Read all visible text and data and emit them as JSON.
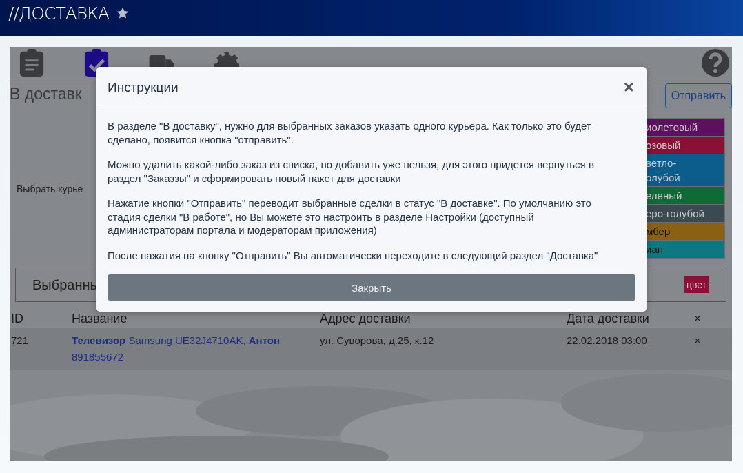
{
  "app_title": "//ДОСТАВКА",
  "favorite": true,
  "tabs": [
    {
      "kind": "list",
      "selected": false
    },
    {
      "kind": "check",
      "selected": true
    },
    {
      "kind": "truck",
      "selected": false
    },
    {
      "kind": "gear",
      "selected": false
    }
  ],
  "section_title": "В доставк",
  "send_button": "Отправить",
  "courier_label": "Выбрать курье",
  "colors": [
    {
      "lines": [
        "иолетовый"
      ],
      "color": "#5e1060"
    },
    {
      "lines": [
        "озовый"
      ],
      "color": "#8a1036"
    },
    {
      "lines": [
        "ветло-",
        "олубой"
      ],
      "color": "#0d5d8c"
    },
    {
      "lines": [
        "еленый"
      ],
      "color": "#0f6b36"
    },
    {
      "lines": [
        "еро-голубой"
      ],
      "color": "#3b4a52"
    },
    {
      "lines": [
        "мбер"
      ],
      "color": "#8a6113"
    },
    {
      "lines": [
        "иан"
      ],
      "color": "#0f7780"
    }
  ],
  "selected_box": {
    "label": "Выбранны",
    "badge": {
      "text": "цвет",
      "color": "#8a1036"
    }
  },
  "table": {
    "columns": [
      "ID",
      "Название",
      "Адрес доставки",
      "Дата доставки",
      "×"
    ],
    "rows": [
      {
        "id": "721",
        "name": "**Телевизор** Samsung UE32J4710AK, **Антон** 891855672",
        "address": "ул. Суворова, д.25, к.12",
        "date": "22.02.2018 03:00",
        "remove": "×"
      }
    ]
  },
  "modal": {
    "title": "Инструкции",
    "close_icon": "×",
    "paragraphs": [
      "В разделе \"В доставку\", нужно для выбранных заказов указать одного курьера. Как только это будет сделано, появится кнопка \"отправить\".",
      "Можно удалить какой-либо заказ из списка, но добавить уже нельзя, для этого придется вернуться в раздел \"Заказзы\" и сформировать новый пакет для доставки",
      "Нажатие кнопки \"Отправить\" переводит выбранные сделки в статус \"В доставке\". По умолчанию это стадия сделки \"В работе\", но Вы можете это настроить в разделе Настройки (доступный администраторам портала и модераторам приложения)",
      "После нажатия на кнопку \"Отправить\" Вы автоматически переходите в следующий раздел \"Доставка\""
    ],
    "button": "Закрыть"
  }
}
